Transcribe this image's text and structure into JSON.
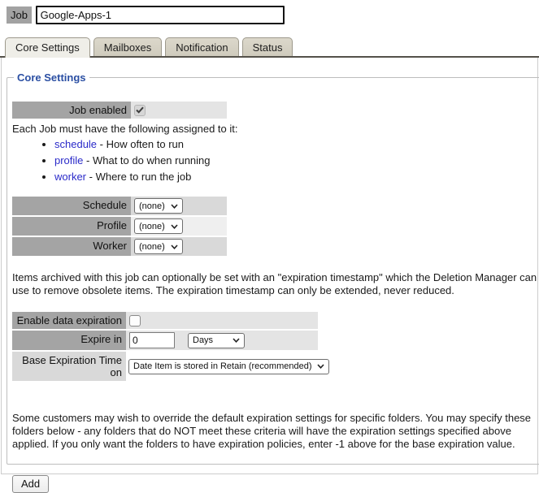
{
  "job_bar": {
    "label": "Job",
    "value": "Google-Apps-1"
  },
  "tabs": [
    {
      "label": "Core Settings",
      "active": true
    },
    {
      "label": "Mailboxes",
      "active": false
    },
    {
      "label": "Notification",
      "active": false
    },
    {
      "label": "Status",
      "active": false
    }
  ],
  "section": {
    "legend": "Core Settings"
  },
  "job_enabled": {
    "label": "Job enabled",
    "checked": true
  },
  "assignment": {
    "intro": "Each Job must have the following assigned to it:",
    "items": [
      {
        "link": "schedule",
        "rest": " - How often to run"
      },
      {
        "link": "profile",
        "rest": " - What to do when running"
      },
      {
        "link": "worker",
        "rest": " - Where to run the job"
      }
    ]
  },
  "selectors": [
    {
      "label": "Schedule",
      "value": "(none)"
    },
    {
      "label": "Profile",
      "value": "(none)"
    },
    {
      "label": "Worker",
      "value": "(none)"
    }
  ],
  "expiration_note": "Items archived with this job can optionally be set with an \"expiration timestamp\" which the Deletion Manager can use to remove obsolete items. The expiration timestamp can only be extended, never reduced.",
  "expiration": {
    "enable_label": "Enable data expiration",
    "enable_checked": false,
    "expire_in_label": "Expire in",
    "expire_value": "0",
    "unit_value": "Days",
    "base_label": "Base Expiration Time on",
    "base_value": "Date Item is stored in Retain (recommended)"
  },
  "folders_note": "Some customers may wish to override the default expiration settings for specific folders. You may specify these folders below - any folders that do NOT meet these criteria will have the expiration settings specified above applied. If you only want the folders to have expiration policies, enter -1 above for the base expiration value.",
  "add_button": "Add",
  "colors": {
    "accent_blue": "#2b4fa3",
    "link_blue": "#2a2ac9",
    "label_gray": "#a4a4a4",
    "value_gray": "#e4e4e4",
    "tab_line": "#54514a"
  }
}
